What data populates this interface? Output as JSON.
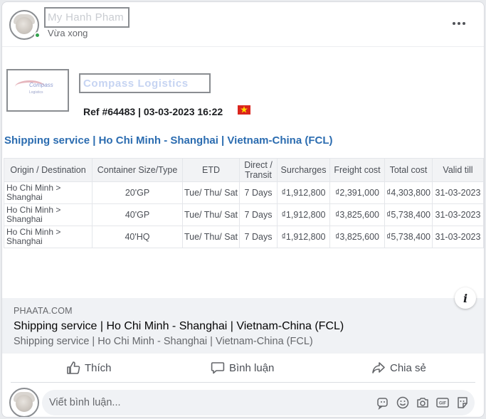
{
  "post": {
    "author": "My Hanh Pham",
    "time": "Vừa xong"
  },
  "quote": {
    "company": "Compass Logistics",
    "ref_line": "Ref #64483 | 03-03-2023 16:22",
    "service_title": "Shipping service | Ho Chi Minh - Shanghai | Vietnam-China (FCL)",
    "columns": [
      "Origin / Destination",
      "Container Size/Type",
      "ETD",
      "Direct / Transit",
      "Surcharges",
      "Freight cost",
      "Total cost",
      "Valid till"
    ],
    "rows": [
      {
        "route": "Ho Chi Minh > Shanghai",
        "container": "20'GP",
        "etd": "Tue/ Thu/ Sat",
        "transit": "7 Days",
        "surcharges": "₫1,912,800",
        "freight": "₫2,391,000",
        "total": "₫4,303,800",
        "valid": "31-03-2023"
      },
      {
        "route": "Ho Chi Minh > Shanghai",
        "container": "40'GP",
        "etd": "Tue/ Thu/ Sat",
        "transit": "7 Days",
        "surcharges": "₫1,912,800",
        "freight": "₫3,825,600",
        "total": "₫5,738,400",
        "valid": "31-03-2023"
      },
      {
        "route": "Ho Chi Minh > Shanghai",
        "container": "40'HQ",
        "etd": "Tue/ Thu/ Sat",
        "transit": "7 Days",
        "surcharges": "₫1,912,800",
        "freight": "₫3,825,600",
        "total": "₫5,738,400",
        "valid": "31-03-2023"
      }
    ]
  },
  "link_preview": {
    "domain": "PHAATA.COM",
    "title": "Shipping service | Ho Chi Minh - Shanghai | Vietnam-China (FCL)",
    "description": "Shipping service | Ho Chi Minh - Shanghai | Vietnam-China (FCL)"
  },
  "actions": {
    "like": "Thích",
    "comment": "Bình luận",
    "share": "Chia sẻ"
  },
  "comment_input": {
    "placeholder": "Viết bình luận..."
  },
  "icons": [
    "more-icon",
    "info-icon",
    "like-icon",
    "comment-icon",
    "share-icon",
    "sticker-icon",
    "emoji-icon",
    "camera-icon",
    "gif-icon",
    "sticker-face-icon"
  ],
  "colors": {
    "service_title": "#2b6cb0",
    "online": "#31a24c",
    "flag_red": "#da251d",
    "flag_star": "#ffdd00"
  }
}
